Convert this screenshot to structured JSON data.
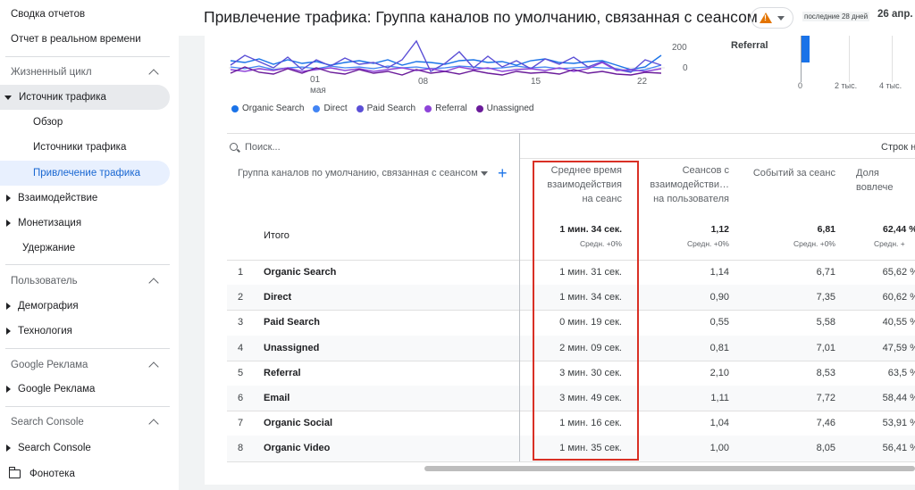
{
  "header": {
    "title": "Привлечение трафика: Группа каналов по умолчанию, связанная с сеансом",
    "date_range_label": "последние 28 дней",
    "date_value": "26 апр. -"
  },
  "sidebar": {
    "top_items": [
      "Сводка отчетов",
      "Отчет в реальном времени"
    ],
    "lifecycle": {
      "label": "Жизненный цикл",
      "traffic_source": "Источник трафика",
      "overview": "Обзор",
      "traffic_sources": "Источники трафика",
      "traffic_acquisition": "Привлечение трафика",
      "engagement": "Взаимодействие",
      "monetization": "Монетизация",
      "retention": "Удержание"
    },
    "user": {
      "label": "Пользователь",
      "demographics": "Демография",
      "technology": "Технология"
    },
    "google_ads": {
      "label": "Google Реклама",
      "item": "Google Реклама"
    },
    "search_console": {
      "label": "Search Console",
      "item": "Search Console"
    },
    "library": "Фонотека"
  },
  "chart": {
    "y_ticks": [
      "200",
      "0"
    ],
    "x_ticks": [
      "01",
      "08",
      "15",
      "22"
    ],
    "x_month": "мая",
    "legend": [
      {
        "name": "Organic Search",
        "color": "#1a73e8"
      },
      {
        "name": "Direct",
        "color": "#4285f4"
      },
      {
        "name": "Paid Search",
        "color": "#5b4fd6"
      },
      {
        "name": "Referral",
        "color": "#8e44d9"
      },
      {
        "name": "Unassigned",
        "color": "#6a1b9a"
      }
    ],
    "bar_label": "Referral",
    "bar_axis": [
      "0",
      "2 тыс.",
      "4 тыс."
    ]
  },
  "table": {
    "search_placeholder": "Поиск...",
    "rows_per_page": "Строк н",
    "dimension_header": "Группа каналов по умолчанию, связанная с сеансом",
    "col_headers": [
      [
        "Среднее время",
        "взаимодействия",
        "на сеанс"
      ],
      [
        "Сеансов с",
        "взаимодействи…",
        "на пользователя"
      ],
      [
        "Событий за сеанс"
      ],
      [
        "Доля вовлече"
      ]
    ],
    "total": {
      "label": "Итого",
      "values": [
        "1 мин. 34 сек.",
        "1,12",
        "6,81",
        "62,44 %"
      ],
      "subs": [
        "Средн. +0%",
        "Средн. +0%",
        "Средн. +0%",
        "Средн. +"
      ]
    },
    "rows": [
      {
        "n": "1",
        "name": "Organic Search",
        "v": [
          "1 мин. 31 сек.",
          "1,14",
          "6,71",
          "65,62 %"
        ]
      },
      {
        "n": "2",
        "name": "Direct",
        "v": [
          "1 мин. 34 сек.",
          "0,90",
          "7,35",
          "60,62 %"
        ]
      },
      {
        "n": "3",
        "name": "Paid Search",
        "v": [
          "0 мин. 19 сек.",
          "0,55",
          "5,58",
          "40,55 %"
        ]
      },
      {
        "n": "4",
        "name": "Unassigned",
        "v": [
          "2 мин. 09 сек.",
          "0,81",
          "7,01",
          "47,59 %"
        ]
      },
      {
        "n": "5",
        "name": "Referral",
        "v": [
          "3 мин. 30 сек.",
          "2,10",
          "8,53",
          "63,5 %"
        ]
      },
      {
        "n": "6",
        "name": "Email",
        "v": [
          "3 мин. 49 сек.",
          "1,11",
          "7,72",
          "58,44 %"
        ]
      },
      {
        "n": "7",
        "name": "Organic Social",
        "v": [
          "1 мин. 16 сек.",
          "1,04",
          "7,46",
          "53,91 %"
        ]
      },
      {
        "n": "8",
        "name": "Organic Video",
        "v": [
          "1 мин. 35 сек.",
          "1,00",
          "8,05",
          "56,41 %"
        ]
      }
    ]
  }
}
